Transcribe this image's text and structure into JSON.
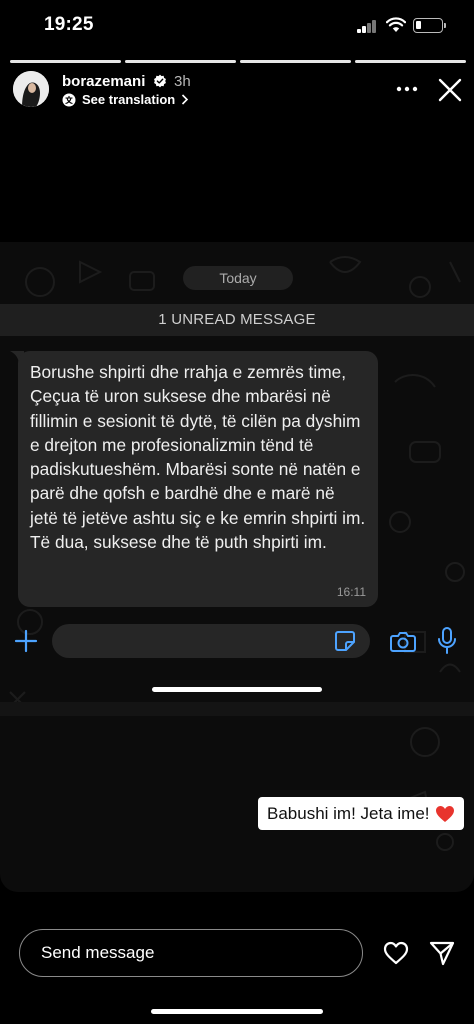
{
  "status_bar": {
    "time": "19:25",
    "battery_level": 0.2
  },
  "story": {
    "segments": 4,
    "username": "borazemani",
    "time_ago": "3h",
    "see_translation": "See translation",
    "icons": {
      "verified": "verified-badge-icon",
      "more": "more-icon",
      "close": "close-icon"
    }
  },
  "chat": {
    "date_pill": "Today",
    "unread_banner": "1 UNREAD MESSAGE",
    "message": {
      "text": "Borushe shpirti dhe rrahja e zemrës time, Çeçua të uron suksese dhe mbarësi në fillimin e sesionit të dytë, të cilën pa dyshim e drejton me profesionalizmin tënd të padiskutueshëm. Mbarësi sonte në natën e parë dhe qofsh e bardhë dhe e marë në jetë të jetëve ashtu siç e ke emrin shpirti im. Të dua, suksese dhe të puth shpirti im.",
      "time": "16:11"
    },
    "composer_icons": [
      "plus-icon",
      "sticker-icon",
      "camera-icon",
      "microphone-icon"
    ],
    "accent_color": "#4da3ff"
  },
  "sticker": {
    "text": "Babushi im! Jeta ime!",
    "emoji": "heart-icon"
  },
  "reply_bar": {
    "placeholder": "Send message",
    "icons": [
      "heart-icon",
      "send-icon"
    ]
  }
}
